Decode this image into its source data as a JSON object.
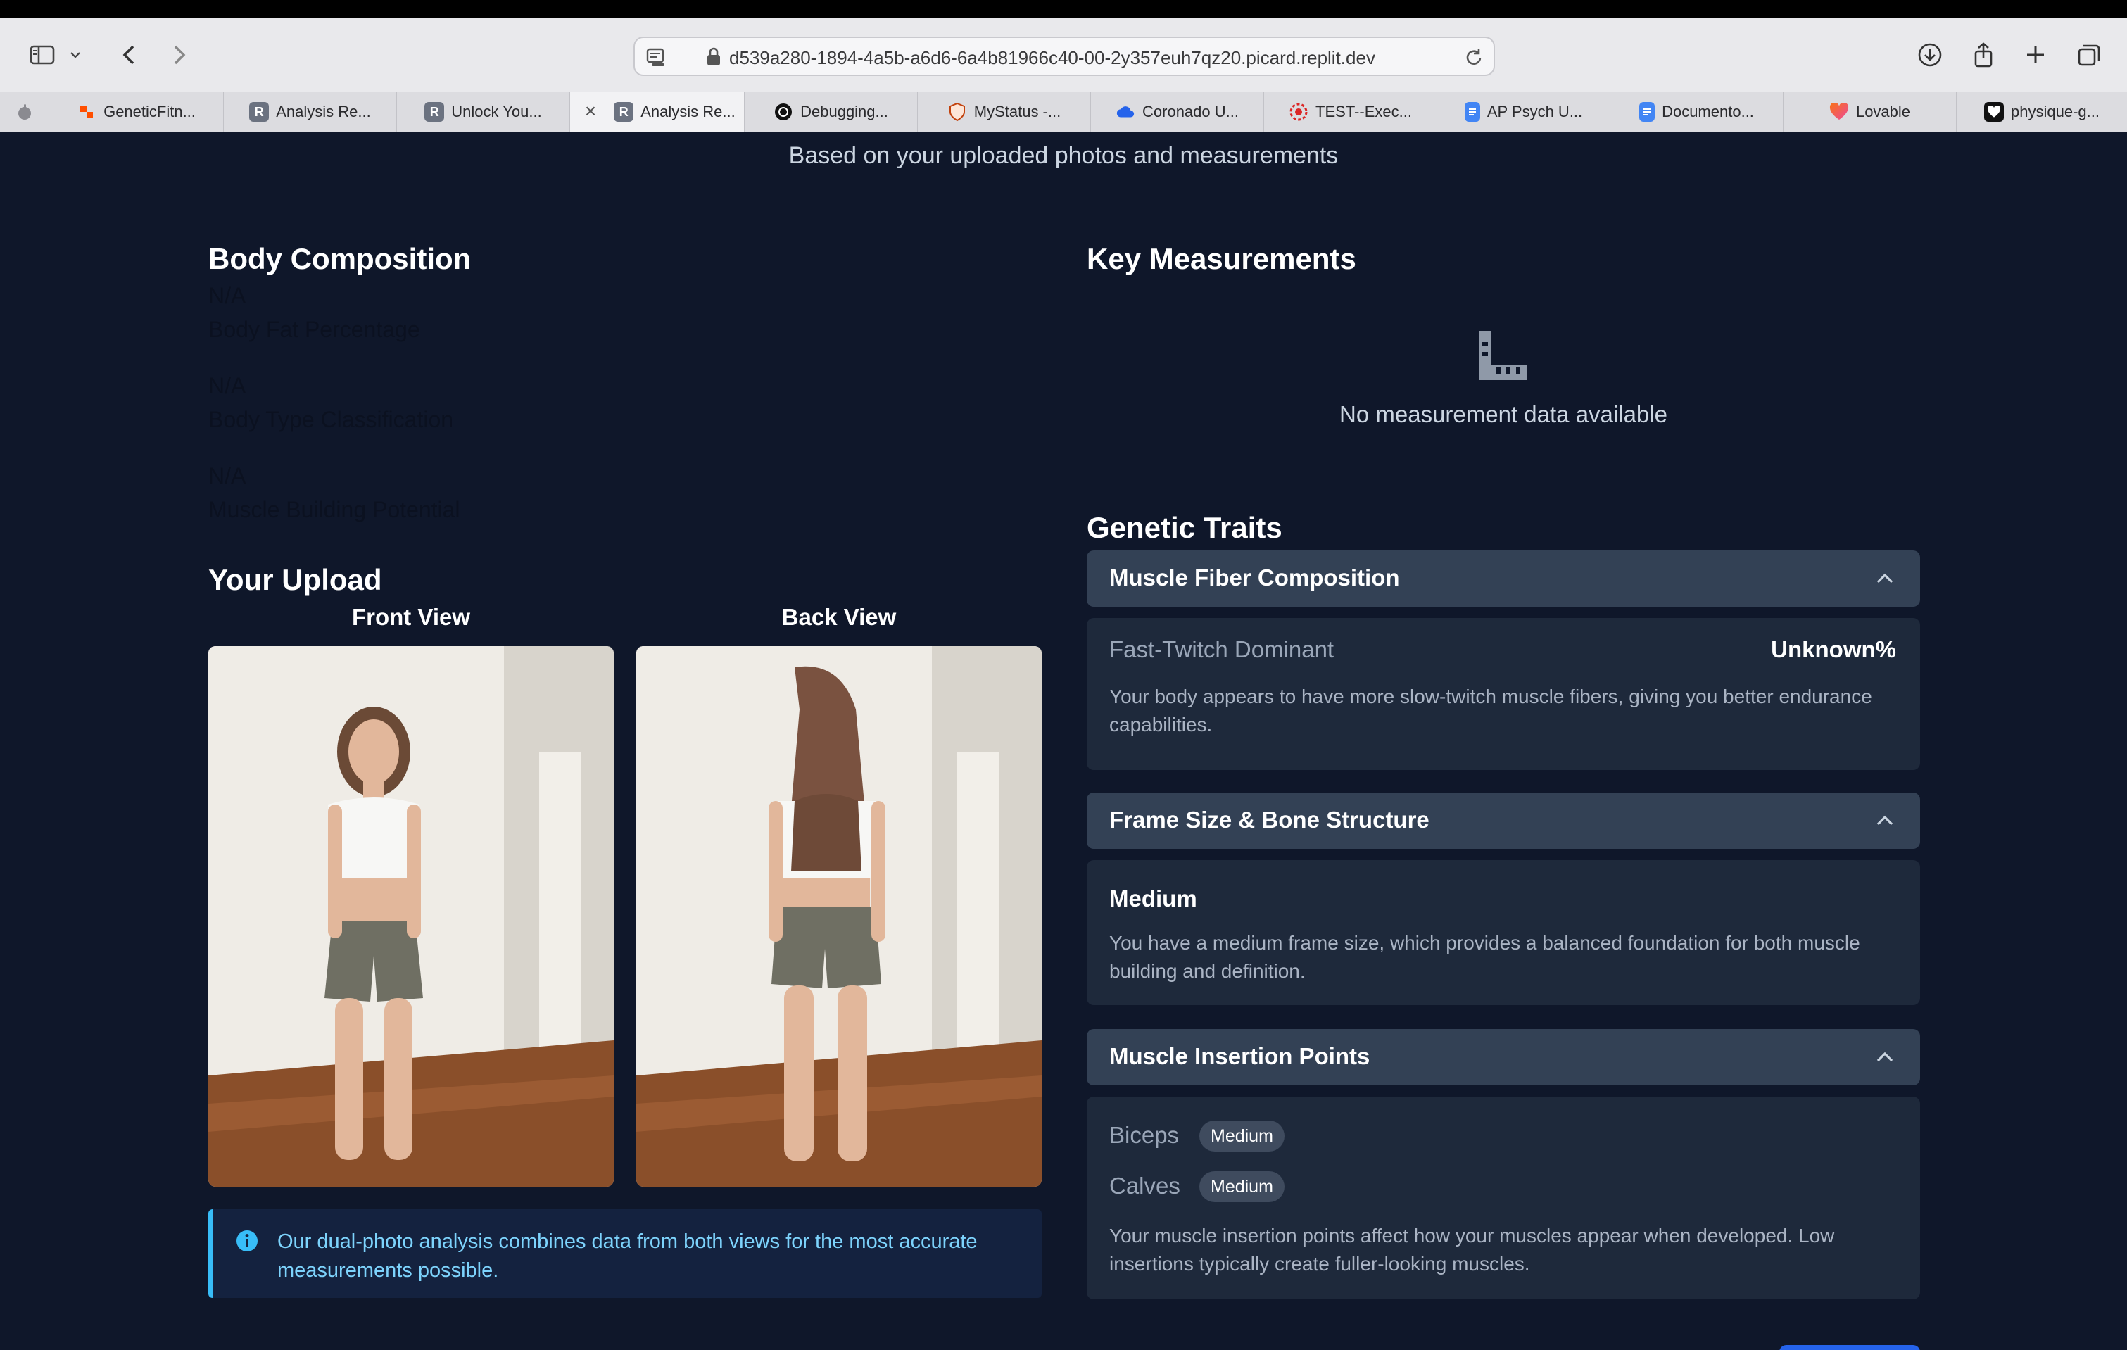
{
  "browser": {
    "url": "d539a280-1894-4a5b-a6d6-6a4b81966c40-00-2y357euh7qz20.picard.replit.dev",
    "tabs": [
      {
        "label": "GeneticFitn...",
        "icon": "zapier-icon",
        "color": "#ff4f00"
      },
      {
        "label": "Analysis Re...",
        "icon": "replit-r-icon",
        "color": "#6b7280"
      },
      {
        "label": "Unlock You...",
        "icon": "replit-r-icon",
        "color": "#6b7280"
      },
      {
        "label": "Analysis Re...",
        "icon": "replit-r-icon",
        "color": "#6b7280",
        "active": true
      },
      {
        "label": "Debugging...",
        "icon": "openai-icon",
        "color": "#111111"
      },
      {
        "label": "MyStatus -...",
        "icon": "shield-icon",
        "color": "#c2410c"
      },
      {
        "label": "Coronado U...",
        "icon": "cloud-icon",
        "color": "#2563eb"
      },
      {
        "label": "TEST--Exec...",
        "icon": "gear-icon",
        "color": "#dc2626"
      },
      {
        "label": "AP Psych U...",
        "icon": "docs-icon",
        "color": "#4285f4"
      },
      {
        "label": "Documento...",
        "icon": "docs-icon",
        "color": "#4285f4"
      },
      {
        "label": "Lovable",
        "icon": "heart-icon",
        "color": "#f97316"
      },
      {
        "label": "physique-g...",
        "icon": "heart-icon",
        "color": "#111111"
      }
    ]
  },
  "page": {
    "subtitle": "Based on your uploaded photos and measurements"
  },
  "body_composition": {
    "title": "Body Composition",
    "stats": [
      {
        "value": "N/A",
        "label": "Body Fat Percentage"
      },
      {
        "value": "N/A",
        "label": "Body Type Classification"
      },
      {
        "value": "N/A",
        "label": "Muscle Building Potential"
      }
    ]
  },
  "upload": {
    "title": "Your Upload",
    "front_label": "Front View",
    "back_label": "Back View",
    "info": "Our dual-photo analysis combines data from both views for the most accurate measurements possible."
  },
  "key_measurements": {
    "title": "Key Measurements",
    "empty_text": "No measurement data available"
  },
  "genetic_traits": {
    "title": "Genetic Traits",
    "fiber": {
      "title": "Muscle Fiber Composition",
      "name": "Fast-Twitch Dominant",
      "percent": "Unknown%",
      "description": "Your body appears to have more slow-twitch muscle fibers, giving you better endurance capabilities."
    },
    "frame": {
      "title": "Frame Size & Bone Structure",
      "value": "Medium",
      "description": "You have a medium frame size, which provides a balanced foundation for both muscle building and definition."
    },
    "insertion": {
      "title": "Muscle Insertion Points",
      "items": [
        {
          "name": "Biceps",
          "badge": "Medium"
        },
        {
          "name": "Calves",
          "badge": "Medium"
        }
      ],
      "description": "Your muscle insertion points affect how your muscles appear when developed. Low insertions typically create fuller-looking muscles."
    }
  },
  "colors": {
    "page_bg": "#0f172a",
    "card_header": "#334155",
    "card_body": "#1e293b",
    "info_accent": "#38bdf8"
  }
}
